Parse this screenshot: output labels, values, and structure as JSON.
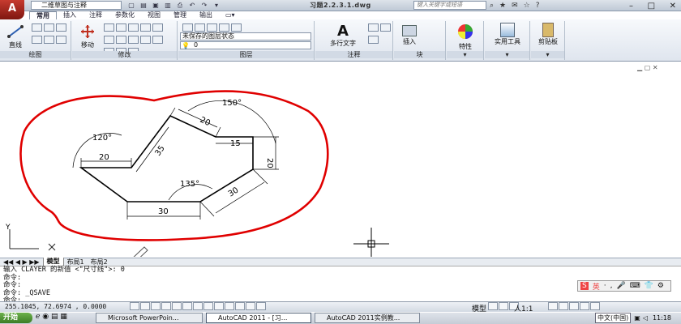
{
  "titlebar": {
    "app_button": "A",
    "workspace": "二维草图与注释",
    "document_title": "习题2.2.3.1.dwg",
    "search_placeholder": "键入关键字或短语",
    "window_controls": [
      "–",
      "□",
      "✕"
    ]
  },
  "ribbon_tabs": [
    "常用",
    "插入",
    "注释",
    "参数化",
    "视图",
    "管理",
    "输出"
  ],
  "ribbon": {
    "draw": {
      "label": "绘图",
      "line_label": "直线"
    },
    "modify": {
      "label": "修改",
      "move_label": "移动"
    },
    "layers": {
      "label": "图层",
      "state": "未保存的图层状态",
      "current_layer": "0"
    },
    "annotation": {
      "label": "注释",
      "mtext_label": "多行文字"
    },
    "block": {
      "label": "块",
      "insert_label": "插入"
    },
    "properties": {
      "label": "特性"
    },
    "utilities": {
      "label": "实用工具"
    },
    "clipboard": {
      "label": "剪贴板"
    }
  },
  "drawing": {
    "dimensions": [
      "150°",
      "20",
      "120°",
      "15",
      "20",
      "35",
      "20",
      "135°",
      "30",
      "30"
    ],
    "ucs_label": "Y"
  },
  "layout_tabs": [
    "模型",
    "布局1",
    "布局2"
  ],
  "command_lines": [
    "输入 CLAYER 的新值 <\"尺寸线\">: 0",
    "命令:",
    "命令:",
    "命令: _QSAVE",
    "命令:"
  ],
  "ime": [
    "S",
    "英",
    "·",
    ",",
    "🎤",
    "⌨",
    "👕",
    "⚙"
  ],
  "status": {
    "coords": "255.1045, 72.6974 , 0.0000",
    "model": "模型",
    "scale": "1:1"
  },
  "taskbar": {
    "start": "开始",
    "tasks": [
      "Microsoft PowerPoin...",
      "AutoCAD 2011 - [习...",
      "AutoCAD 2011实例教..."
    ],
    "language": "中文(中国)",
    "time": "11:18"
  },
  "colors": {
    "accent_red": "#e00000",
    "ribbon_bg": "#dfe5ee"
  }
}
